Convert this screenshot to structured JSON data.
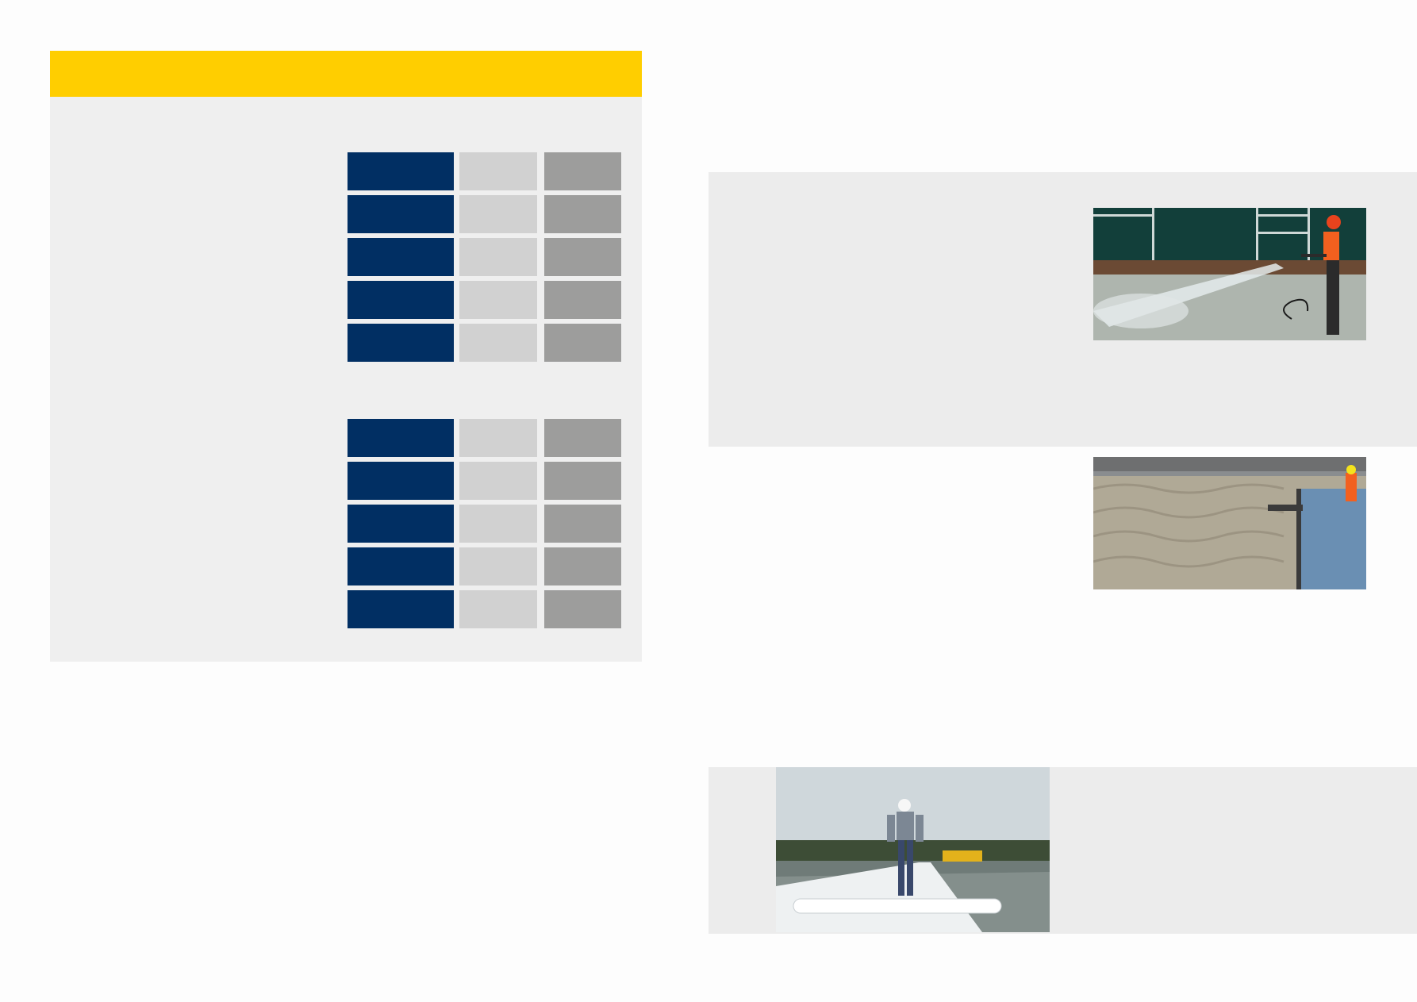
{
  "colors": {
    "header_yellow": "#ffce00",
    "panel_grey": "#efefef",
    "navy": "#012f63",
    "light_grey": "#d1d1d1",
    "mid_grey": "#9d9d9c"
  },
  "tables": [
    {
      "rows": 5
    },
    {
      "rows": 5
    }
  ],
  "images": [
    {
      "name": "photo-pressure-washing"
    },
    {
      "name": "photo-floor-screed"
    },
    {
      "name": "photo-membrane-roll"
    }
  ]
}
